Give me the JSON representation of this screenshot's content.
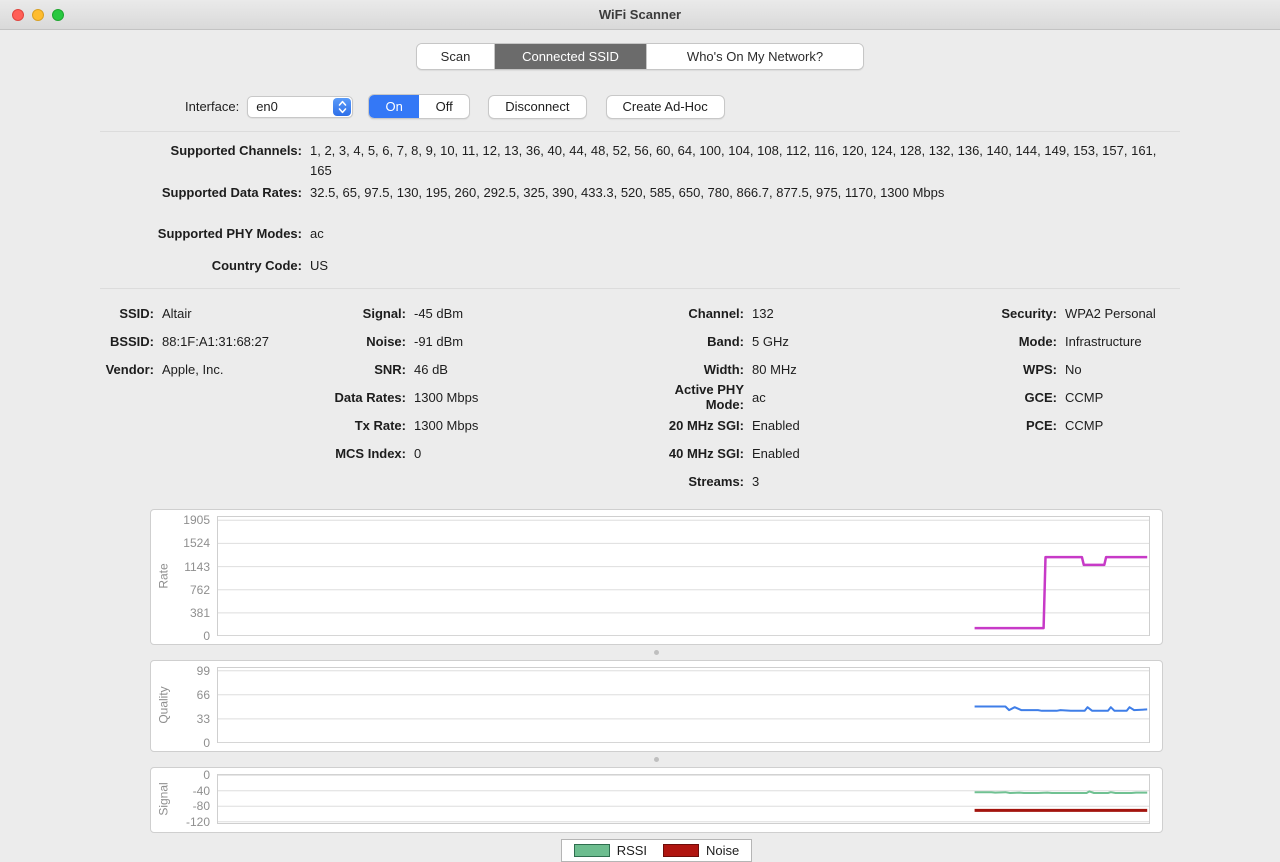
{
  "window": {
    "title": "WiFi Scanner"
  },
  "tabs": [
    {
      "label": "Scan",
      "selected": false
    },
    {
      "label": "Connected SSID",
      "selected": true
    },
    {
      "label": "Who's On My Network?",
      "selected": false
    }
  ],
  "toolbar": {
    "interface_label": "Interface:",
    "interface_value": "en0",
    "on_label": "On",
    "off_label": "Off",
    "disconnect_label": "Disconnect",
    "adhoc_label": "Create Ad-Hoc"
  },
  "capabilities": {
    "rows": [
      {
        "label": "Supported Channels:",
        "value": "1, 2, 3, 4, 5, 6, 7, 8, 9, 10, 11, 12, 13, 36, 40, 44, 48, 52, 56, 60, 64, 100, 104, 108, 112, 116, 120, 124, 128, 132, 136, 140, 144, 149, 153, 157, 161, 165"
      },
      {
        "label": "Supported Data Rates:",
        "value": "32.5, 65, 97.5, 130, 195, 260, 292.5, 325, 390, 433.3, 520, 585, 650, 780, 866.7, 877.5, 975, 1170, 1300 Mbps"
      },
      {
        "label": "Supported PHY Modes:",
        "value": "ac"
      },
      {
        "label": "Country Code:",
        "value": "US"
      }
    ]
  },
  "details": {
    "col1": [
      {
        "label": "SSID:",
        "value": "Altair"
      },
      {
        "label": "BSSID:",
        "value": "88:1F:A1:31:68:27"
      },
      {
        "label": "Vendor:",
        "value": "Apple, Inc."
      }
    ],
    "col2": [
      {
        "label": "Signal:",
        "value": "-45 dBm"
      },
      {
        "label": "Noise:",
        "value": "-91 dBm"
      },
      {
        "label": "SNR:",
        "value": "46 dB"
      },
      {
        "label": "Data Rates:",
        "value": "1300 Mbps"
      },
      {
        "label": "Tx Rate:",
        "value": "1300 Mbps"
      },
      {
        "label": "MCS Index:",
        "value": "0"
      }
    ],
    "col3": [
      {
        "label": "Channel:",
        "value": "132"
      },
      {
        "label": "Band:",
        "value": "5 GHz"
      },
      {
        "label": "Width:",
        "value": "80 MHz"
      },
      {
        "label": "Active PHY Mode:",
        "value": "ac"
      },
      {
        "label": "20 MHz SGI:",
        "value": "Enabled"
      },
      {
        "label": "40 MHz SGI:",
        "value": "Enabled"
      },
      {
        "label": "Streams:",
        "value": "3"
      }
    ],
    "col4": [
      {
        "label": "Security:",
        "value": "WPA2 Personal"
      },
      {
        "label": "Mode:",
        "value": "Infrastructure"
      },
      {
        "label": "WPS:",
        "value": "No"
      },
      {
        "label": "GCE:",
        "value": "CCMP"
      },
      {
        "label": "PCE:",
        "value": "CCMP"
      }
    ]
  },
  "chart_data": [
    {
      "type": "line",
      "ylabel": "Rate",
      "yticks": [
        0,
        381,
        762,
        1143,
        1524,
        1905
      ],
      "ylim": [
        0,
        1976
      ],
      "xlim": [
        0,
        100
      ],
      "grid": true,
      "legend_position": "none",
      "series": [
        {
          "name": "Rate",
          "color": "#c73ac7",
          "width": 2.5,
          "points": [
            [
              81.2,
              130
            ],
            [
              88.6,
              130
            ],
            [
              88.8,
              1300
            ],
            [
              92.7,
              1300
            ],
            [
              92.9,
              1170
            ],
            [
              95.1,
              1170
            ],
            [
              95.3,
              1300
            ],
            [
              99.7,
              1300
            ]
          ]
        }
      ]
    },
    {
      "type": "line",
      "ylabel": "Quality",
      "yticks": [
        0,
        33,
        66,
        99
      ],
      "ylim": [
        0,
        104
      ],
      "xlim": [
        0,
        100
      ],
      "grid": true,
      "legend_position": "none",
      "series": [
        {
          "name": "Quality",
          "color": "#3f7ee8",
          "width": 2,
          "points": [
            [
              81.2,
              50
            ],
            [
              84.5,
              50
            ],
            [
              84.9,
              45
            ],
            [
              85.5,
              49
            ],
            [
              86.2,
              45
            ],
            [
              88,
              45
            ],
            [
              88.4,
              44
            ],
            [
              90,
              44
            ],
            [
              90.4,
              45
            ],
            [
              91.5,
              44
            ],
            [
              93,
              44
            ],
            [
              93.3,
              49
            ],
            [
              93.8,
              44
            ],
            [
              95.5,
              44
            ],
            [
              95.8,
              49
            ],
            [
              96.2,
              44
            ],
            [
              97.5,
              44
            ],
            [
              97.8,
              49
            ],
            [
              98.3,
              45
            ],
            [
              99.7,
              46
            ]
          ]
        }
      ]
    },
    {
      "type": "line",
      "ylabel": "Signal",
      "yticks": [
        -120,
        -80,
        -40,
        0
      ],
      "ylim": [
        -126,
        3
      ],
      "xlim": [
        0,
        100
      ],
      "grid": true,
      "legend_position": "bottom",
      "series": [
        {
          "name": "RSSI",
          "color": "#70c192",
          "width": 2,
          "points": [
            [
              81.2,
              -44
            ],
            [
              83,
              -44
            ],
            [
              83.4,
              -45
            ],
            [
              84.5,
              -44
            ],
            [
              85,
              -46
            ],
            [
              86,
              -45
            ],
            [
              86.5,
              -46
            ],
            [
              88,
              -46
            ],
            [
              89,
              -45
            ],
            [
              89.5,
              -46
            ],
            [
              91,
              -46
            ],
            [
              93.2,
              -46
            ],
            [
              93.5,
              -42
            ],
            [
              94,
              -46
            ],
            [
              95.5,
              -46
            ],
            [
              95.8,
              -44
            ],
            [
              96.3,
              -46
            ],
            [
              98,
              -46
            ],
            [
              98.5,
              -45
            ],
            [
              99.7,
              -45
            ]
          ]
        },
        {
          "name": "Noise",
          "color": "#a3140e",
          "width": 3,
          "points": [
            [
              81.2,
              -91
            ],
            [
              99.7,
              -91
            ]
          ]
        }
      ]
    }
  ],
  "legend": {
    "items": [
      {
        "label": "RSSI",
        "color": "#6dbd8f",
        "border": "#2f6e4f"
      },
      {
        "label": "Noise",
        "color": "#b01510",
        "border": "#6e0d0a"
      }
    ]
  }
}
